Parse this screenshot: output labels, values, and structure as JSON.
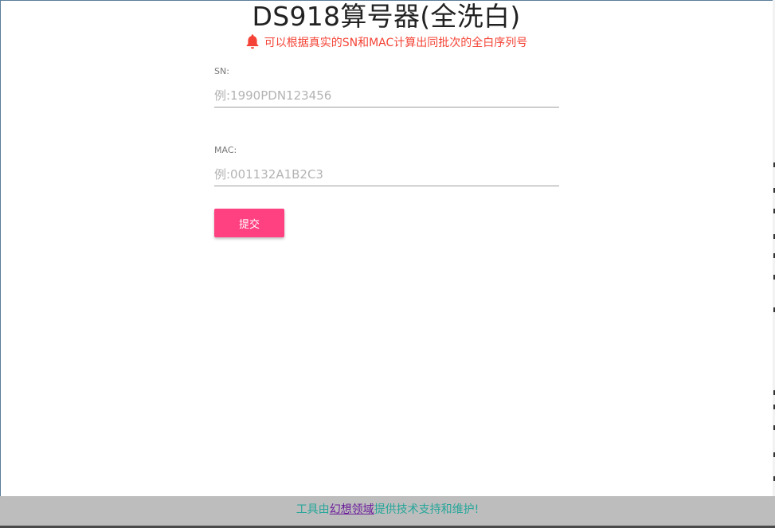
{
  "page": {
    "title": "DS918算号器(全洗白)",
    "notice": "可以根据真实的SN和MAC计算出同批次的全白序列号",
    "notice_icon": "bell-icon",
    "notice_color": "#f44336"
  },
  "form": {
    "sn": {
      "label": "SN:",
      "value": "",
      "placeholder": "例:1990PDN123456"
    },
    "mac": {
      "label": "MAC:",
      "value": "",
      "placeholder": "例:001132A1B2C3"
    },
    "submit_label": "提交",
    "submit_color": "#ff4081"
  },
  "footer": {
    "prefix": "工具由",
    "link": "幻想领域",
    "suffix": "提供技术支持和维护!",
    "background": "#bdbdbd",
    "text_color": "#26a69a"
  }
}
